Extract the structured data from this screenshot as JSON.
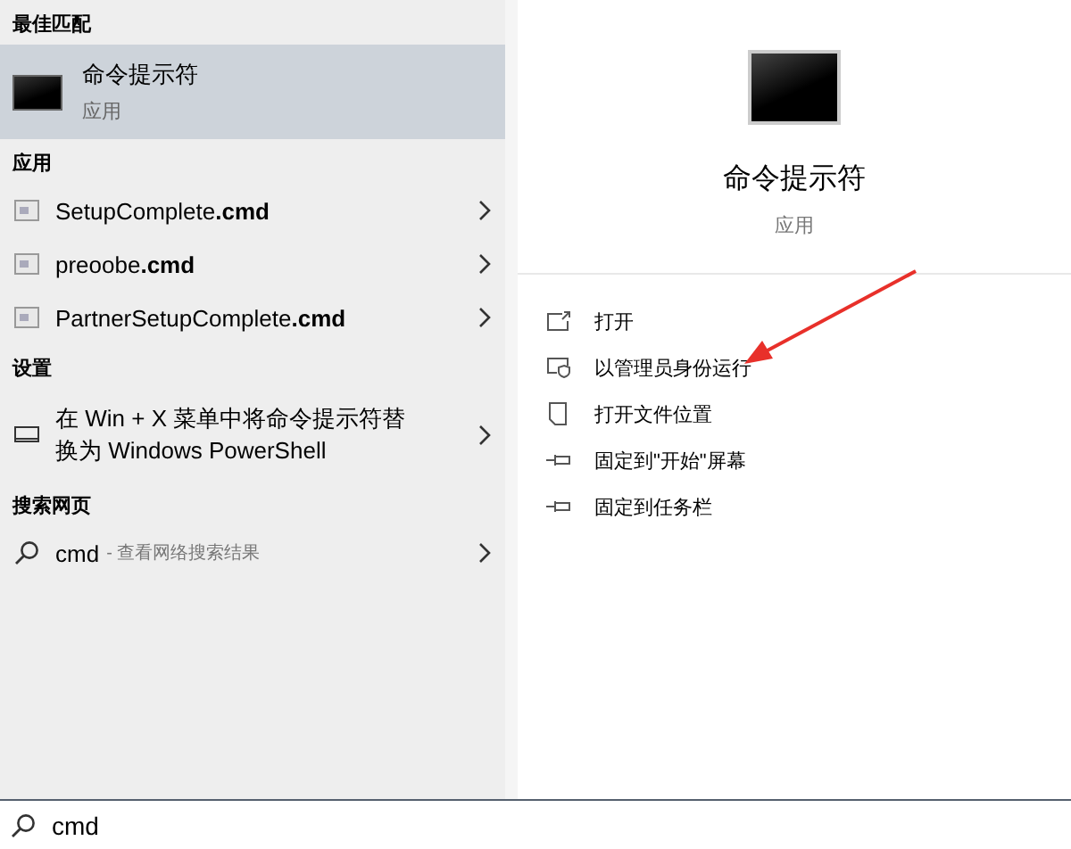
{
  "best_match": {
    "heading": "最佳匹配",
    "item": {
      "title": "命令提示符",
      "subtitle": "应用",
      "selected": true
    }
  },
  "apps": {
    "heading": "应用",
    "items": [
      {
        "label": "SetupComplete**.cmd**"
      },
      {
        "label": "preoobe**.cmd**"
      },
      {
        "label": "PartnerSetupComplete**.cmd**"
      }
    ]
  },
  "settings": {
    "heading": "设置",
    "items": [
      {
        "label": "在 Win + X 菜单中将命令提示符替换为 Windows PowerShell"
      }
    ]
  },
  "web": {
    "heading": "搜索网页",
    "items": [
      {
        "query": "cmd",
        "hint": "- 查看网络搜索结果"
      }
    ]
  },
  "detail": {
    "title": "命令提示符",
    "subtitle": "应用",
    "actions": [
      {
        "kind": "open",
        "label": "打开"
      },
      {
        "kind": "admin",
        "label": "以管理员身份运行"
      },
      {
        "kind": "folder",
        "label": "打开文件位置"
      },
      {
        "kind": "pin",
        "label": "固定到\"开始\"屏幕"
      },
      {
        "kind": "pin",
        "label": "固定到任务栏"
      }
    ]
  },
  "search_box": {
    "value": "cmd"
  }
}
